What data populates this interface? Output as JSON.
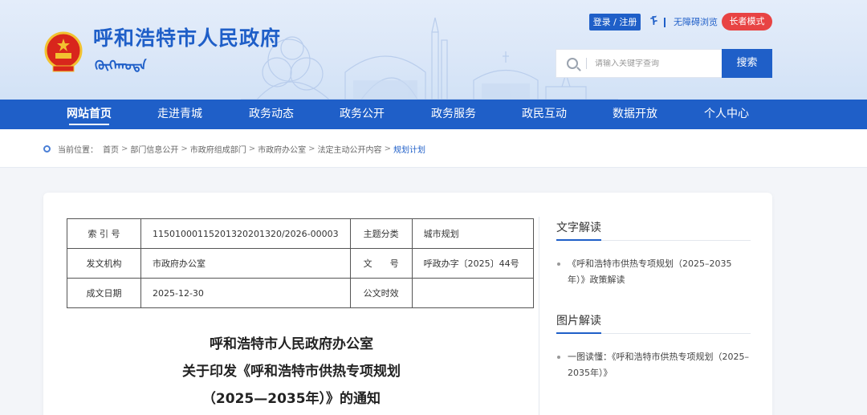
{
  "header": {
    "site_title": "呼和浩特市人民政府",
    "mongolian_title": "ᠬᠥᠬᠡᠬᠣᠲᠠ",
    "login_label": "登录 / 注册",
    "mongolian_toggle": "ᠮ",
    "accessibility_label": "无障碍浏览",
    "elder_mode_label": "长者模式",
    "search_placeholder": "请输入关键字查询",
    "search_button": "搜索"
  },
  "nav": {
    "items": [
      {
        "label": "网站首页"
      },
      {
        "label": "走进青城"
      },
      {
        "label": "政务动态"
      },
      {
        "label": "政务公开"
      },
      {
        "label": "政务服务"
      },
      {
        "label": "政民互动"
      },
      {
        "label": "数据开放"
      },
      {
        "label": "个人中心"
      }
    ]
  },
  "breadcrumb": {
    "prefix": "当前位置：",
    "items": [
      "首页",
      "部门信息公开",
      "市政府组成部门",
      "市政府办公室",
      "法定主动公开内容",
      "规划计划"
    ],
    "separator": ">"
  },
  "meta": {
    "index_label": "索 引 号",
    "index_value": "11501000115201320201320/2026-00003",
    "topic_label": "主题分类",
    "topic_value": "城市规划",
    "issuer_label": "发文机构",
    "issuer_value": "市政府办公室",
    "docno_label": "文　　号",
    "docno_value": "呼政办字〔2025〕44号",
    "date_label": "成文日期",
    "date_value": "2025-12-30",
    "validity_label": "公文时效",
    "validity_value": ""
  },
  "document": {
    "title_line1": "呼和浩特市人民政府办公室",
    "title_line2": "关于印发《呼和浩特市供热专项规划",
    "title_line3": "（2025—2035年）》的通知"
  },
  "sidebar": {
    "text_heading": "文字解读",
    "text_items": [
      "《呼和浩特市供热专项规划（2025–2035年）》政策解读"
    ],
    "image_heading": "图片解读",
    "image_items": [
      "一图读懂：《呼和浩特市供热专项规划（2025–2035年）》"
    ]
  },
  "colors": {
    "brand_blue": "#1f5fc8",
    "elder_red": "#e84343"
  }
}
